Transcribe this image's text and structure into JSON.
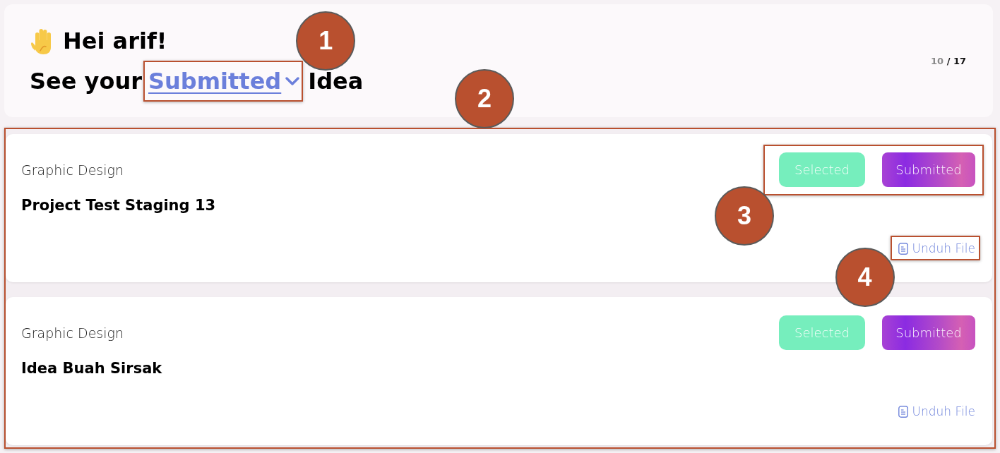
{
  "header": {
    "greeting": "Hei arif!",
    "prompt_before": "See your",
    "status_filter": {
      "label": "Submitted",
      "callout": "1"
    },
    "prompt_after": "Idea",
    "counter": {
      "current": "10",
      "separator": "/",
      "total": "17"
    }
  },
  "ideas_panel": {
    "callout": "2",
    "items": [
      {
        "category": "Graphic Design",
        "title": "Project Test Staging 13",
        "badges": {
          "callout": "3",
          "items": [
            {
              "label": "Selected",
              "kind": "selected"
            },
            {
              "label": "Submitted",
              "kind": "submitted"
            }
          ]
        },
        "download": {
          "label": "Unduh File",
          "callout": "4"
        }
      },
      {
        "category": "Graphic Design",
        "title": "Idea Buah Sirsak",
        "badges": {
          "items": [
            {
              "label": "Selected",
              "kind": "selected"
            },
            {
              "label": "Submitted",
              "kind": "submitted"
            }
          ]
        },
        "download": {
          "label": "Unduh File"
        }
      }
    ]
  }
}
